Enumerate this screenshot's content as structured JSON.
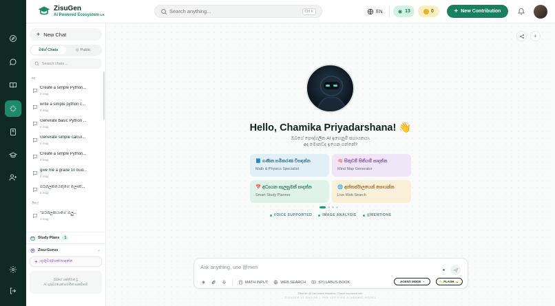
{
  "rail": {
    "items": [
      {
        "name": "explore-icon"
      },
      {
        "name": "chat-icon"
      },
      {
        "name": "library-icon"
      },
      {
        "name": "ai-sparkle-icon",
        "active": true
      },
      {
        "name": "notebook-icon"
      },
      {
        "name": "graduation-cap-icon"
      },
      {
        "name": "add-user-icon"
      },
      {
        "name": "settings-icon"
      },
      {
        "name": "logout-icon"
      }
    ]
  },
  "header": {
    "brand_name": "ZisuGen",
    "brand_tagline": "AI Powered Ecosystem",
    "brand_tagline_suffix": "LK",
    "search_placeholder": "Search anything...",
    "search_shortcut": "Ctrl K",
    "language": "EN",
    "credits": "13",
    "coins": "0",
    "new_contribution_label": "New Contribution"
  },
  "sidebar": {
    "new_chat_label": "New Chat",
    "tabs": [
      {
        "label": "මගේ Chats",
        "active": true
      },
      {
        "label": "Public",
        "active": false
      }
    ],
    "search_placeholder": "Search chats...",
    "groups": [
      {
        "label": "අද",
        "items": [
          {
            "title": "Create a simple Python...",
            "time": "2 mag"
          },
          {
            "title": "write a simple python c...",
            "time": "4 mag"
          },
          {
            "title": "Generate basic Python ...",
            "time": "2 mag"
          },
          {
            "title": "Generate simple calcul...",
            "time": "2 mag"
          },
          {
            "title": "Create a simple Python...",
            "time": "4 mag"
          },
          {
            "title": "give me a grade 10 bud...",
            "time": "2 mag"
          },
          {
            "title": "පරිශීලකයෙකුගේ ලොක්...",
            "time": "6 mag"
          }
        ]
      },
      {
        "label": "ඊයේ",
        "items": [
          {
            "title": "\"පරිශීලකයාගේ ඔලු...",
            "time": "4 mag"
          }
        ]
      }
    ],
    "study_plans_label": "Study Plans",
    "study_plans_count": "1",
    "gurus_label": "Zisu-Gurus",
    "guru_button_label": "ගුරුවරයෙක් සාදන්න",
    "footer_line1": "ඔබගේ ශක්තිමත් වූ",
    "footer_line2": "AI ගුරුවරයෙක් සමඟින් සාකච්ඡාව"
  },
  "main": {
    "greeting": "Hello, Chamika Priyadarshana! 👋",
    "subgreeting_line1": "ඔබගේ පෞද්ගලික AI ඉගෙනුම් සහායකයා.",
    "subgreeting_line2": "අද මොනවද ඉගෙන ගන්නේ?",
    "cards": [
      {
        "title": "📘 ගණිත සමීකරණ විසඳන්න",
        "subtitle": "Math & Physics Specialist"
      },
      {
        "title": "🧠 සිතුවම් සිතියම් සාදන්න",
        "subtitle": "Mind Map Generator"
      },
      {
        "title": "📅 අධ්‍යයන සැලසුමක් සාදන්න",
        "subtitle": "Smart Study Planner"
      },
      {
        "title": "🌐 අන්තර්ජාලයෙන් සොයන්න",
        "subtitle": "Live Web Search"
      }
    ],
    "features": [
      "VOICE SUPPORTED",
      "IMAGE ANALYSIS",
      "@MENTIONS"
    ],
    "composer": {
      "placeholder": "Ask anything, use @men",
      "tools": {
        "math_input": "MATH INPUT",
        "web_search": "WEB SEARCH",
        "syllabus_book": "SYLLABUS BOOK"
      },
      "agent_mode_label": "AGENT MODE",
      "flash_label": "FLASH"
    },
    "disclaimer": "ZisuGen AI can make mistakes. Check important info.",
    "disclaimer_model": "ZISUGEN V2 ENGINE • 99% VERIFIED ACADEMIC MODEL"
  }
}
